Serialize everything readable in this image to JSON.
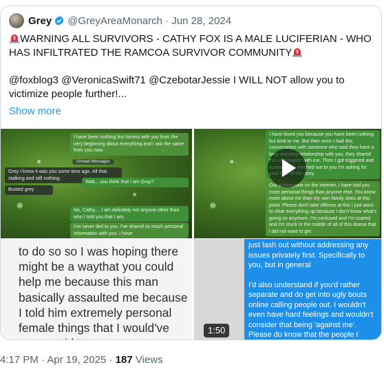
{
  "quoted_tweet": {
    "display_name": "Grey",
    "handle": "@GreyAreaMonarch",
    "separator": "·",
    "date": "Jun 28, 2024",
    "headline_text": "WARNING ALL SURVIVORS - CATHY FOX IS A MALE LUCIFERIAN - WHO HAS INFILTRATED THE RAMCOA SURVIVOR COMMUNITY",
    "body_text": "@foxblog3 @VeronicaSwift71 @CzebotarJessie I WILL NOT allow you to victimize people further!...",
    "show_more": "Show more",
    "verified_color": "#1d9bf0",
    "alarm_color": "#dd2e44"
  },
  "media": {
    "panel_a": {
      "msg_1": "I have been nothing but honest with you from the very beginning about everything and I ask the same from you now.",
      "unread_label": "Unread Messages",
      "msg_2": "Grey I knew it was you some time ago. All that stalking and still nothing.",
      "msg_3": "Busted grey",
      "msg_4": "Wait... you think that I am Gray?",
      "msg_5": "No, Cathy.... I am definitely not anyone other than who I told you that I am.",
      "msg_6": "I've never lied to you. I've shared so much personal information with you. I have"
    },
    "panel_b": {
      "msg_1": "I have loved you because you have been nothing but kind to me. But then once I had this conversation with someone who said they have a long-standing relationship with you, they shared this information with me. Then I got triggered and scared and I reached out to you I'm asking for your side of the story.",
      "msg_2": "Out of everyone on the Internet, I have told you more personal things than anyone else. You know more about me than my own family does at this point. Please don't take offense at this I just want to clear everything up because I don't know what's going on anymore. I'm confused and I'm scared and I'm stuck in the middle of all of this drama that I did not want to get"
    },
    "panel_c_text": "to do so so I was hoping there might be a waythat you could help me because this man basically assaulted me because I told him extremely personal female things that I would've never said to a man",
    "panel_d": {
      "para_1": "just lash out without addressing any issues privately first. Specifically to you, but in general",
      "para_2": "I'd also understand if you'd rather separate and do get into ugly bouts online calling people out. I wouldn't even have hard feelings and wouldn't consider that being 'against me'. Please do know that the people I adamantly call out is"
    },
    "duration": "1:50"
  },
  "footer": {
    "time": "4:17 PM",
    "separator": "·",
    "date": "Apr 19, 2025",
    "views_count": "187",
    "views_label": "Views"
  }
}
